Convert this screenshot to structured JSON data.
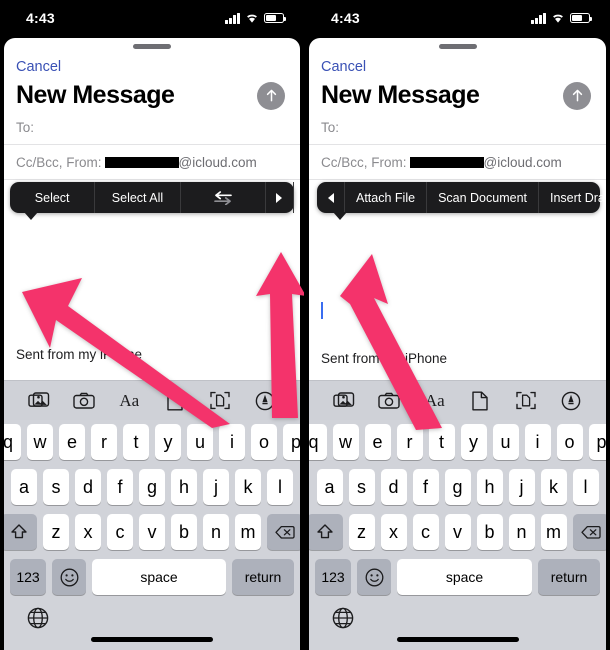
{
  "status_bar": {
    "time": "4:43",
    "icons": [
      "cellular-signal-icon",
      "wifi-icon",
      "battery-icon"
    ]
  },
  "colors": {
    "accent_blue": "#3a51b5",
    "caret_blue": "#3a6df0",
    "menu_black": "#1c1c1e",
    "arrow_pink": "#f4336b",
    "send_gray": "#8e8e93",
    "keyboard_bg": "#d1d3d9",
    "key_white": "#ffffff",
    "key_gray": "#adb1bb"
  },
  "panels": [
    {
      "id": "left",
      "compose": {
        "cancel_label": "Cancel",
        "title": "New Message",
        "send_icon": "send-arrow-up-icon",
        "to_label": "To:",
        "to_value": "",
        "from_label": "Cc/Bcc, From:",
        "from_value_redacted": true,
        "from_domain": "@icloud.com"
      },
      "context_menu": {
        "items": [
          {
            "label": "Select",
            "type": "text"
          },
          {
            "label": "Select All",
            "type": "text"
          },
          {
            "label": "",
            "type": "icon",
            "icon": "paste-arrows-icon"
          },
          {
            "label": "",
            "type": "icon",
            "icon": "chevron-right-icon"
          }
        ]
      },
      "body": {
        "has_caret": false,
        "signature": "Sent from my iPhone"
      }
    },
    {
      "id": "right",
      "compose": {
        "cancel_label": "Cancel",
        "title": "New Message",
        "send_icon": "send-arrow-up-icon",
        "to_label": "To:",
        "to_value": "",
        "from_label": "Cc/Bcc, From:",
        "from_value_redacted": true,
        "from_domain": "@icloud.com"
      },
      "context_menu": {
        "items": [
          {
            "label": "",
            "type": "icon",
            "icon": "chevron-left-icon"
          },
          {
            "label": "Attach File",
            "type": "text"
          },
          {
            "label": "Scan Document",
            "type": "text"
          },
          {
            "label": "Insert Drawing",
            "type": "text"
          },
          {
            "label": "",
            "type": "icon",
            "icon": "chevron-right-icon"
          }
        ]
      },
      "body": {
        "has_caret": true,
        "signature": "Sent from my iPhone"
      }
    }
  ],
  "keyboard": {
    "toolbar_icons": [
      "photos-icon",
      "camera-icon",
      "text-format-aa-icon",
      "document-icon",
      "scan-document-icon",
      "markup-pen-icon"
    ],
    "text_format_label": "Aa",
    "row1": [
      "q",
      "w",
      "e",
      "r",
      "t",
      "y",
      "u",
      "i",
      "o",
      "p"
    ],
    "row2": [
      "a",
      "s",
      "d",
      "f",
      "g",
      "h",
      "j",
      "k",
      "l"
    ],
    "row3": [
      "z",
      "x",
      "c",
      "v",
      "b",
      "n",
      "m"
    ],
    "shift_icon": "shift-arrow-up-icon",
    "backspace_icon": "backspace-delete-icon",
    "numbers_label": "123",
    "emoji_icon": "emoji-smiley-icon",
    "space_label": "space",
    "return_label": "return",
    "globe_icon": "globe-language-icon"
  },
  "annotations": {
    "arrows": [
      {
        "name": "arrow-pointing-to-select-menu",
        "panel": "left"
      },
      {
        "name": "arrow-pointing-to-chevron-right",
        "panel": "left"
      },
      {
        "name": "arrow-pointing-to-attach-file",
        "panel": "right"
      }
    ]
  }
}
